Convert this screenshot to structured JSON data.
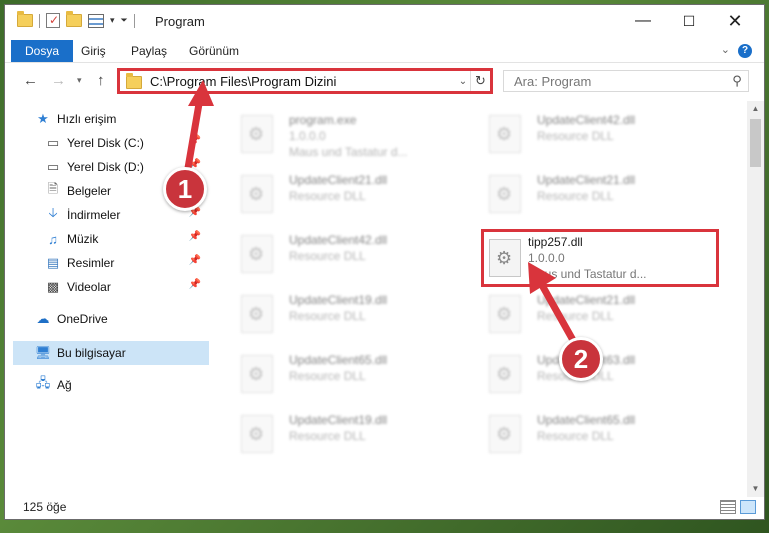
{
  "window": {
    "title": "Program"
  },
  "ribbon": {
    "tabs": [
      "Dosya",
      "Giriş",
      "Paylaş",
      "Görünüm"
    ],
    "help": "?"
  },
  "address": {
    "path": "C:\\Program Files\\Program Dizini",
    "search_placeholder": "Ara: Program"
  },
  "sidebar": {
    "items": [
      {
        "label": "Hızlı erişim"
      },
      {
        "label": "Yerel Disk (C:)"
      },
      {
        "label": "Yerel Disk (D:)"
      },
      {
        "label": "Belgeler"
      },
      {
        "label": "İndirmeler"
      },
      {
        "label": "Müzik"
      },
      {
        "label": "Resimler"
      },
      {
        "label": "Videolar"
      },
      {
        "label": "OneDrive"
      },
      {
        "label": "Bu bilgisayar"
      },
      {
        "label": "Ağ"
      }
    ]
  },
  "files": {
    "left": [
      {
        "name": "program.exe",
        "line2": "1.0.0.0",
        "line3": "Maus und Tastatur d..."
      },
      {
        "name": "UpdateClient21.dll",
        "line2": "Resource DLL"
      },
      {
        "name": "UpdateClient42.dll",
        "line2": "Resource DLL"
      },
      {
        "name": "UpdateClient19.dll",
        "line2": "Resource DLL"
      },
      {
        "name": "UpdateClient65.dll",
        "line2": "Resource DLL"
      },
      {
        "name": "UpdateClient19.dll",
        "line2": "Resource DLL"
      }
    ],
    "right": [
      {
        "name": "UpdateClient42.dll",
        "line2": "Resource DLL"
      },
      {
        "name": "UpdateClient21.dll",
        "line2": "Resource DLL"
      },
      {
        "name": "UpdateClient21.dll",
        "line2": "Resource DLL"
      },
      {
        "name": "UpdateClient63.dll",
        "line2": "Resource DLL"
      },
      {
        "name": "UpdateClient65.dll",
        "line2": "Resource DLL"
      }
    ],
    "highlighted": {
      "name": "tipp257.dll",
      "version": "1.0.0.0",
      "description": "Maus und Tastatur d..."
    }
  },
  "status": {
    "count": "125 öğe"
  },
  "markers": {
    "one": "1",
    "two": "2"
  },
  "colors": {
    "accent": "#1a6fc9",
    "highlight": "#d9343c"
  }
}
